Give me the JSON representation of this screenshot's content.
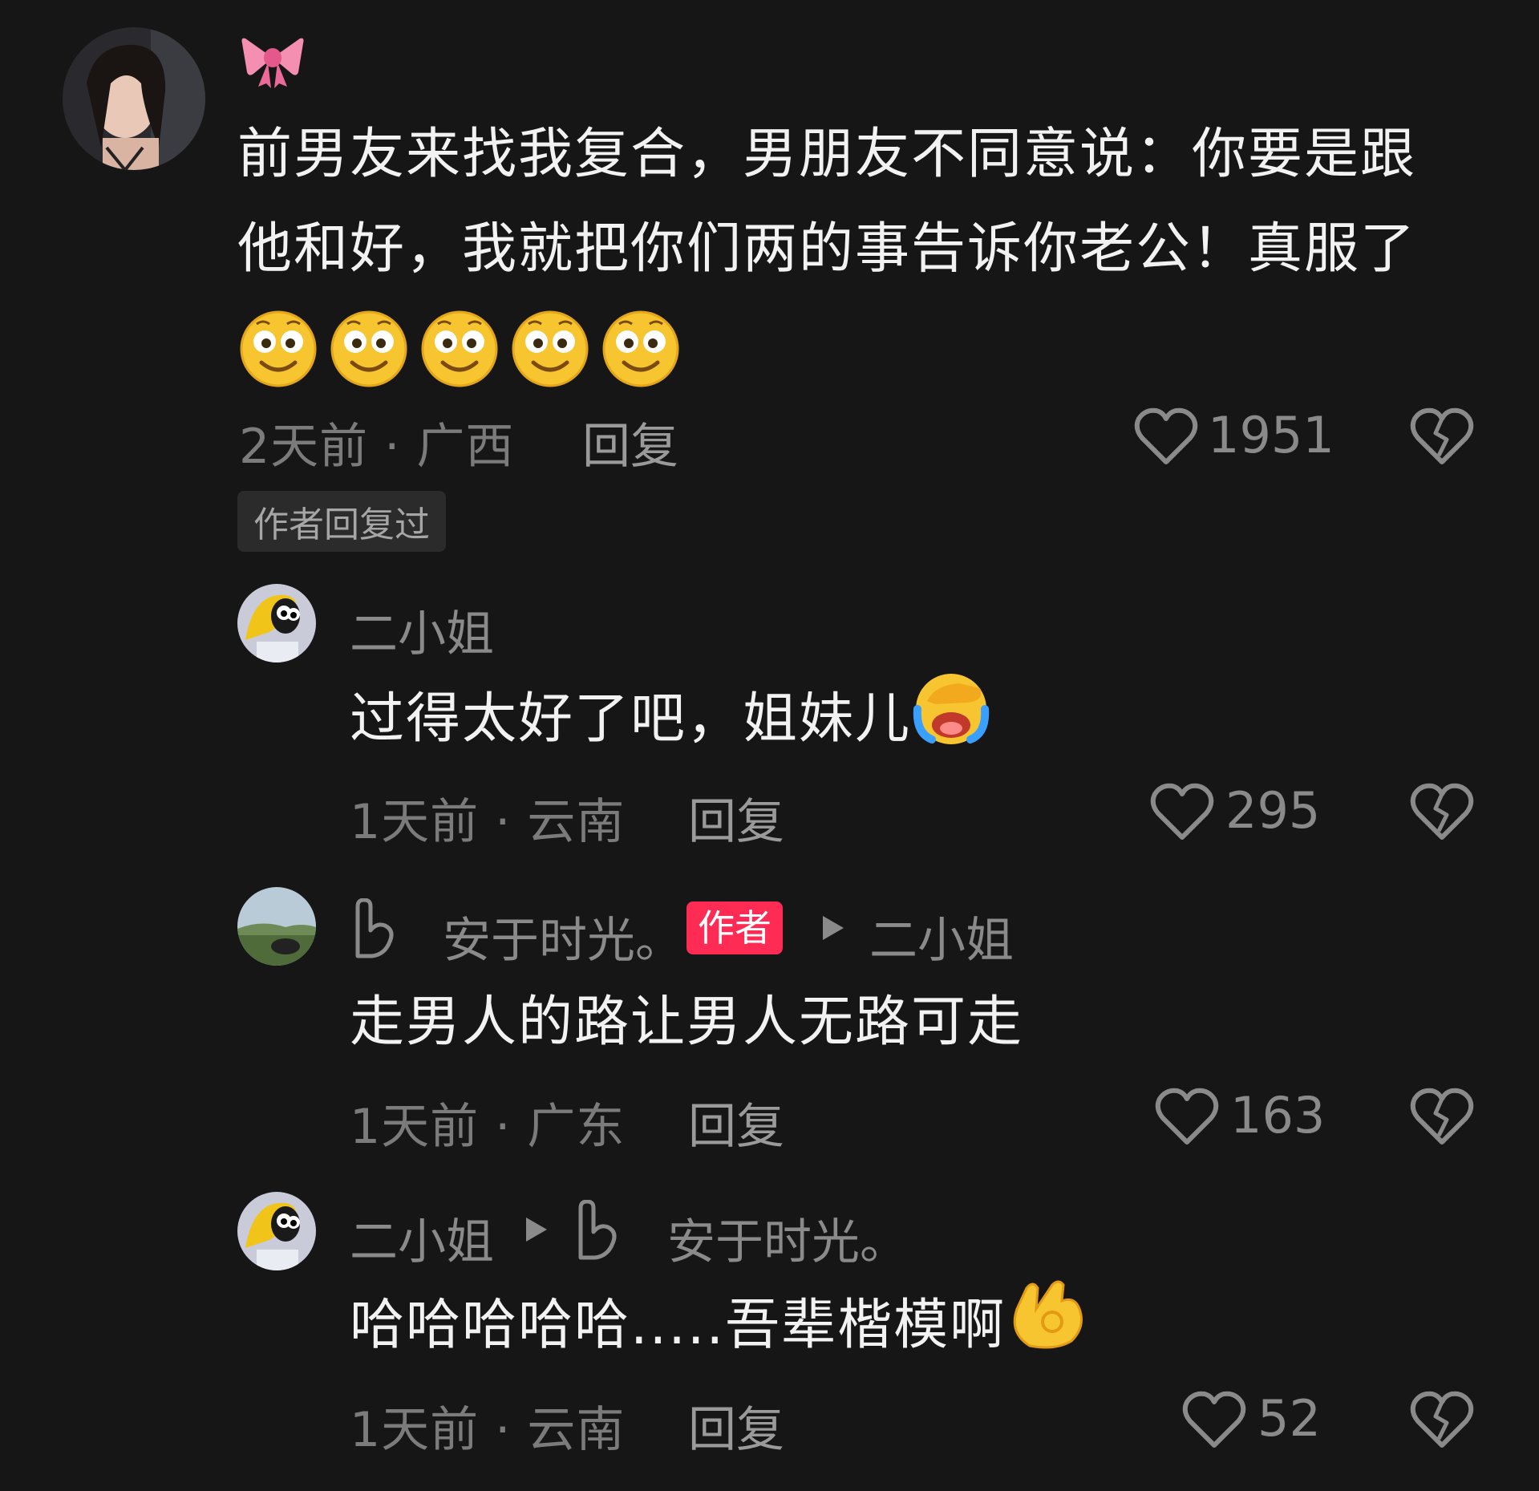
{
  "comments": [
    {
      "badge_icon": "ribbon-bow-icon",
      "text_line1": "前男友来找我复合，男朋友不同意说：你要是跟",
      "text_line2": "他和好，我就把你们两的事告诉你老公！真服了",
      "emojis": [
        "grin-emoji",
        "grin-emoji",
        "grin-emoji",
        "grin-emoji",
        "grin-emoji"
      ],
      "meta": "2天前 · 广西",
      "reply_label": "回复",
      "likes": "1951",
      "author_replied_tag": "作者回复过"
    },
    {
      "username": "二小姐",
      "text": "过得太好了吧，姐妹儿",
      "text_emoji": "crying-facepalm-emoji",
      "meta": "1天前 · 云南",
      "reply_label": "回复",
      "likes": "295"
    },
    {
      "username": "安于时光。",
      "author_tag": "作者",
      "reply_to": "二小姐",
      "text": "走男人的路让男人无路可走",
      "meta": "1天前 · 广东",
      "reply_label": "回复",
      "likes": "163"
    },
    {
      "username": "二小姐",
      "reply_to": "安于时光。",
      "text": "哈哈哈哈哈.....吾辈楷模啊",
      "text_emoji": "ok-hand-emoji",
      "meta": "1天前 · 云南",
      "reply_label": "回复",
      "likes": "52"
    }
  ],
  "colors": {
    "background": "#161616",
    "author_tag": "#fe2c55",
    "muted_text": "#7b7b7b"
  }
}
